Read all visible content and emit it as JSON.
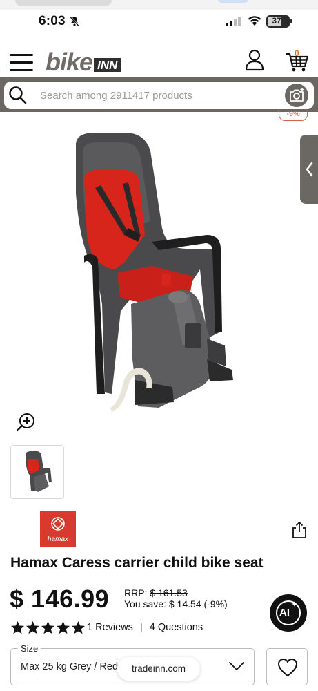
{
  "status_bar": {
    "time": "6:03",
    "battery": "37",
    "icons": [
      "bell-slash-icon",
      "cellular-signal-icon",
      "wifi-icon",
      "battery-icon"
    ]
  },
  "header": {
    "logo_bike": "bike",
    "logo_inn": "INN",
    "cart_count": "0",
    "icons": [
      "hamburger-menu-icon",
      "user-icon",
      "cart-icon"
    ]
  },
  "search": {
    "placeholder": "Search among 2911417 products",
    "icons": [
      "search-icon",
      "camera-search-icon"
    ]
  },
  "product": {
    "discount_tag": "-9%",
    "brand": "hamax",
    "title": "Hamax Caress carrier child bike seat",
    "price": "$ 146.99",
    "rrp_label": "RRP:",
    "rrp_value": "$ 161.53",
    "you_save": "You save: $ 14.54 (-9%)",
    "rating_stars": 5,
    "reviews": "1 Reviews",
    "separator": "|",
    "questions": "4 Questions"
  },
  "size": {
    "label": "Size",
    "value": "Max 25 kg Grey / Red"
  },
  "domain_pill": "tradeinn.com",
  "ai_button": "AI",
  "colors": {
    "header_gray": "#6b6864",
    "brand_red": "#d93a2f",
    "discount_red": "#e05a4a",
    "cart_orange": "#e0741c",
    "seat_red": "#d8251c",
    "seat_gray": "#4a4a4c"
  }
}
